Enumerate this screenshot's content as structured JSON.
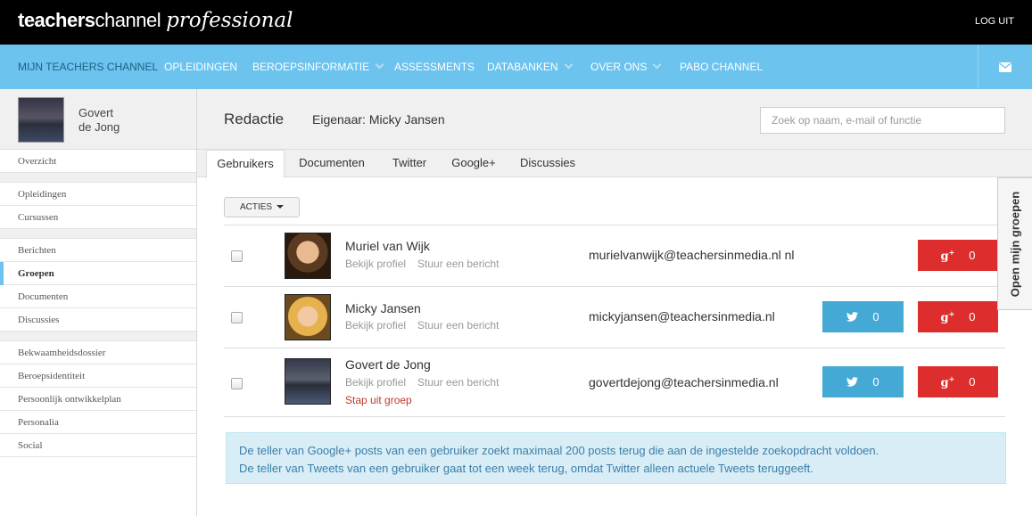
{
  "header": {
    "logo_part1": "teachers",
    "logo_part2": "channel",
    "logo_part3": "professional",
    "logout": "LOG UIT"
  },
  "nav": {
    "items": [
      {
        "label": "MIJN TEACHERS CHANNEL"
      },
      {
        "label": "OPLEIDINGEN"
      },
      {
        "label": "BEROEPSINFORMATIE"
      },
      {
        "label": "ASSESSMENTS"
      },
      {
        "label": "DATABANKEN"
      },
      {
        "label": "OVER ONS"
      },
      {
        "label": "PABO CHANNEL"
      }
    ],
    "mail_icon": "envelope-icon"
  },
  "sidebar": {
    "profile_first": "Govert",
    "profile_last": "de Jong",
    "items": [
      "Overzicht",
      "Opleidingen",
      "Cursussen",
      "Berichten",
      "Groepen",
      "Documenten",
      "Discussies",
      "Bekwaamheidsdossier",
      "Beroepsidentiteit",
      "Persoonlijk ontwikkelplan",
      "Personalia",
      "Social"
    ],
    "active": "Groepen"
  },
  "group": {
    "title": "Redactie",
    "owner": "Eigenaar: Micky Jansen",
    "search_placeholder": "Zoek op naam, e-mail of functie"
  },
  "tabs": [
    "Gebruikers",
    "Documenten",
    "Twitter",
    "Google+",
    "Discussies"
  ],
  "actions_label": "ACTIES",
  "users": [
    {
      "name": "Muriel van Wijk",
      "profile_link": "Bekijk profiel",
      "message_link": "Stuur een bericht",
      "email": "murielvanwijk@teachersinmedia.nl",
      "email_suffix": "nl",
      "twitter_count": null,
      "google_count": "0"
    },
    {
      "name": "Micky Jansen",
      "profile_link": "Bekijk profiel",
      "message_link": "Stuur een bericht",
      "email": "mickyjansen@teachersinmedia.nl",
      "twitter_count": "0",
      "google_count": "0"
    },
    {
      "name": "Govert de Jong",
      "profile_link": "Bekijk profiel",
      "message_link": "Stuur een bericht",
      "leave_link": "Stap uit groep",
      "email": "govertdejong@teachersinmedia.nl",
      "twitter_count": "0",
      "google_count": "0"
    }
  ],
  "google_label": "g+",
  "info": {
    "line1": "De teller van Google+ posts van een gebruiker zoekt maximaal 200 posts terug die aan de ingestelde zoekopdracht voldoen.",
    "line2": "De teller van Tweets van een gebruiker gaat tot een week terug, omdat Twitter alleen actuele Tweets teruggeeft."
  },
  "side_tab": "Open mijn groepen",
  "colors": {
    "nav_bg": "#6cc3ee",
    "twitter": "#45a9d6",
    "google": "#dd2d2d",
    "info_bg": "#d9edf7"
  }
}
